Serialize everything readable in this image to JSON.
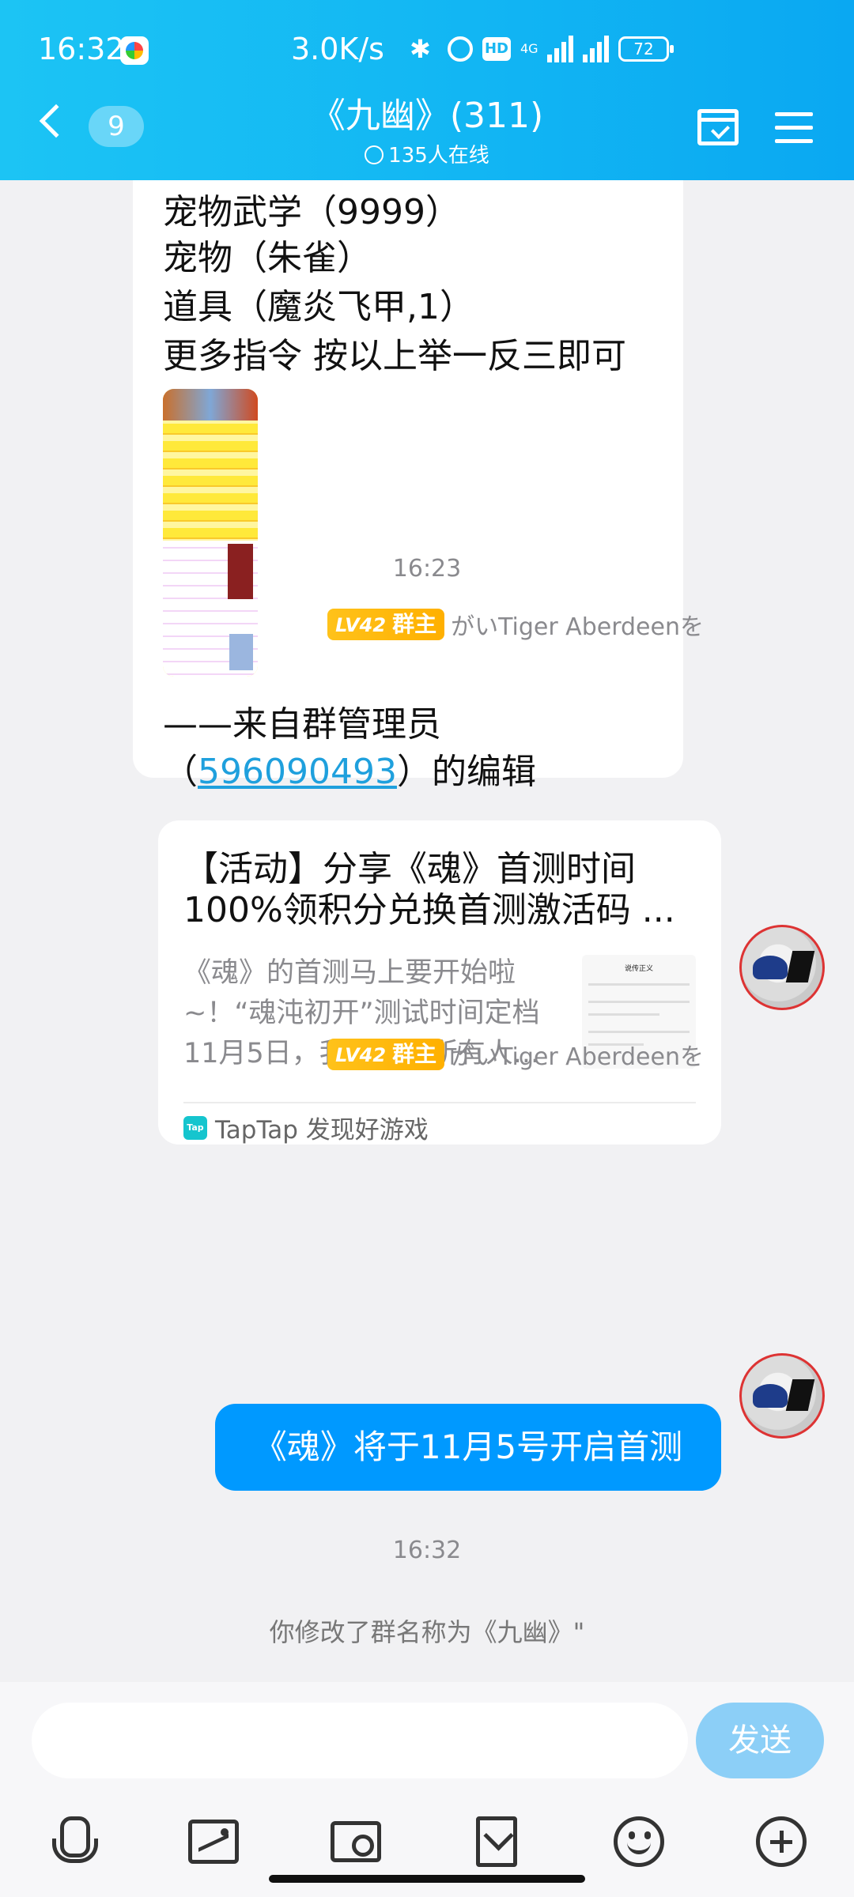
{
  "status_bar": {
    "time": "16:32",
    "speed": "3.0K/s",
    "network": "4G",
    "hd": "HD",
    "battery": "72"
  },
  "header": {
    "unread_count": "9",
    "title": "《九幽》(311)",
    "online": "135人在线"
  },
  "messages": {
    "cmd_partial": "宠物武学（9999）",
    "cmd_lines": [
      "宠物（朱雀）",
      "道具（魔炎飞甲,1）",
      "更多指令 按以上举一反三即可"
    ],
    "from_prefix": "——来自群管理员",
    "from_open": "（",
    "from_id": "596090493",
    "from_suffix": "）的编辑",
    "time1": "16:23",
    "sender_level": "LV42",
    "sender_role": "群主",
    "sender_name": "がいTiger Aberdeenを",
    "card": {
      "title_line1": "【活动】分享《魂》首测时间",
      "title_line2": "100%领积分兑换首测激活码 ...",
      "desc_lines": [
        "《魂》的首测马上要开始啦",
        "~！“魂沌初开”测试时间定档",
        "11月5日，我们团队所有人..."
      ],
      "thumb_title": "说传正义",
      "source": "TapTap 发现好游戏"
    },
    "text_message": "《魂》将于11月5号开启首测",
    "time2": "16:32",
    "system_notice": "你修改了群名称为《九幽》\""
  },
  "input": {
    "value": "",
    "send_label": "发送"
  },
  "colors": {
    "header": "#12b6f3",
    "bubble": "#0099ff",
    "badge": "#ffb000",
    "link": "#1fa0dd"
  }
}
